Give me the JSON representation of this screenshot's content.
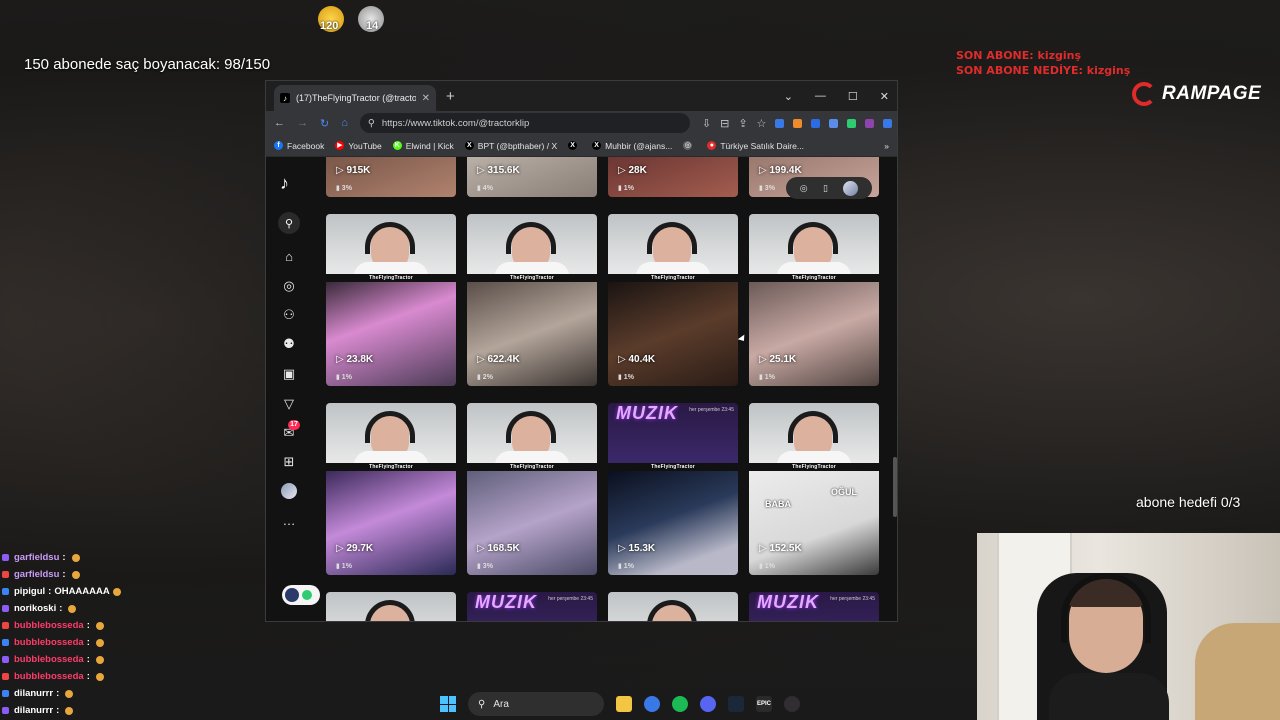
{
  "overlay": {
    "goal_text": "150 abonede saç boyanacak: 98/150",
    "emote_counts": [
      "120",
      "14"
    ],
    "son_abone": "SON ABONE: kizginş",
    "son_abone_nediye": "SON ABONE NEDİYE: kizginş",
    "brand": "RAMPAGE",
    "abone_hedefi": "abone hedefi 0/3"
  },
  "chat": [
    {
      "user": "garfieldsu",
      "message": "",
      "color": "#c89cf7"
    },
    {
      "user": "garfieldsu",
      "message": "",
      "color": "#c89cf7"
    },
    {
      "user": "pipigul",
      "message": "OHAAAAAA",
      "color": "#ffffff"
    },
    {
      "user": "norikoski",
      "message": "",
      "color": "#ffffff"
    },
    {
      "user": "bubblebosseda",
      "message": "",
      "color": "#ff3b6b"
    },
    {
      "user": "bubblebosseda",
      "message": "",
      "color": "#ff3b6b"
    },
    {
      "user": "bubblebosseda",
      "message": "",
      "color": "#ff3b6b"
    },
    {
      "user": "bubblebosseda",
      "message": "",
      "color": "#ff3b6b"
    },
    {
      "user": "dilanurrr",
      "message": "",
      "color": "#ffffff"
    },
    {
      "user": "dilanurrr",
      "message": "",
      "color": "#ffffff"
    }
  ],
  "browser": {
    "tab_title": "(17)TheFlyingTractor (@tractorkl",
    "new_tab": "+",
    "window_controls": {
      "minimize": "—",
      "maximize": "☐",
      "close": "✕"
    },
    "url": "https://www.tiktok.com/@tractorklip",
    "profile_letter": "U",
    "bookmarks": [
      {
        "label": "Facebook",
        "color": "#1877f2",
        "glyph": "f"
      },
      {
        "label": "YouTube",
        "color": "#ff0000",
        "glyph": "▶"
      },
      {
        "label": "Elwind | Kick",
        "color": "#53fc18",
        "glyph": "K"
      },
      {
        "label": "BPT (@bpthaber) / X",
        "color": "#000000",
        "glyph": "X"
      },
      {
        "label": "",
        "color": "#000000",
        "glyph": "X"
      },
      {
        "label": "Muhbir (@ajans...",
        "color": "#000000",
        "glyph": "X"
      },
      {
        "label": "",
        "color": "#666666",
        "glyph": "◎"
      },
      {
        "label": "Türkiye Satılık Daire...",
        "color": "#e02b2b",
        "glyph": "●"
      }
    ],
    "bookmarks_more": "»"
  },
  "tiktok": {
    "notification_count": "17",
    "channel_name": "TheFlyingTractor",
    "top_row": [
      {
        "views": "915K",
        "pct": "3%"
      },
      {
        "views": "315.6K",
        "pct": "4%"
      },
      {
        "views": "28K",
        "pct": "1%"
      },
      {
        "views": "199.4K",
        "pct": "3%"
      }
    ],
    "row1": [
      {
        "views": "23.8K",
        "pct": "1%"
      },
      {
        "views": "622.4K",
        "pct": "2%"
      },
      {
        "views": "40.4K",
        "pct": "1%"
      },
      {
        "views": "25.1K",
        "pct": "1%"
      }
    ],
    "row2": [
      {
        "views": "29.7K",
        "pct": "1%"
      },
      {
        "views": "168.5K",
        "pct": "3%"
      },
      {
        "views": "15.3K",
        "pct": "1%"
      },
      {
        "views": "152.5K",
        "pct": "1%"
      }
    ],
    "muzik_label": "MUZIK",
    "muzik_date": "her perşembe 23:45",
    "baba_label": "BABA",
    "ogul_label": "OĞUL"
  },
  "taskbar": {
    "search_placeholder": "Ara",
    "apps": [
      "file-explorer",
      "chrome",
      "spotify",
      "discord",
      "steam",
      "epic-games",
      "obs"
    ]
  }
}
